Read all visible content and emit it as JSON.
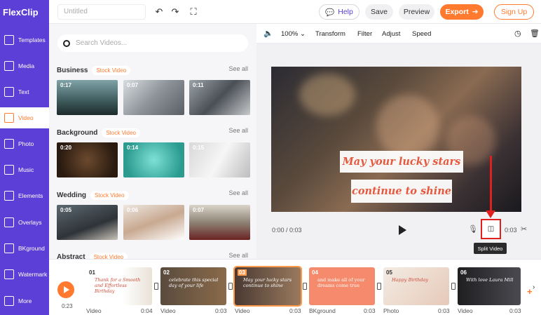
{
  "app": {
    "logo_text": "FlexClip"
  },
  "topbar": {
    "title_placeholder": "Untitled",
    "help_label": "Help",
    "save_label": "Save",
    "preview_label": "Preview",
    "export_label": "Export",
    "signup_label": "Sign Up"
  },
  "leftnav": {
    "items": [
      {
        "label": "Templates",
        "icon": "templates-icon"
      },
      {
        "label": "Media",
        "icon": "media-icon"
      },
      {
        "label": "Text",
        "icon": "text-icon"
      },
      {
        "label": "Video",
        "icon": "video-icon",
        "active": true
      },
      {
        "label": "Photo",
        "icon": "photo-icon"
      },
      {
        "label": "Music",
        "icon": "music-icon"
      },
      {
        "label": "Elements",
        "icon": "elements-icon"
      },
      {
        "label": "Overlays",
        "icon": "overlays-icon"
      },
      {
        "label": "BKground",
        "icon": "background-icon"
      },
      {
        "label": "Watermark",
        "icon": "watermark-icon"
      },
      {
        "label": "More",
        "icon": "more-icon"
      }
    ]
  },
  "panel": {
    "search_placeholder": "Search Videos...",
    "stock_badge": "Stock Video",
    "see_all": "See all",
    "sections": [
      {
        "title": "Business",
        "durations": [
          "0:17",
          "0:07",
          "0:11"
        ]
      },
      {
        "title": "Background",
        "durations": [
          "0:20",
          "0:14",
          "0:15"
        ]
      },
      {
        "title": "Wedding",
        "durations": [
          "0:05",
          "0:06",
          "0:07"
        ]
      },
      {
        "title": "Abstract"
      }
    ]
  },
  "editor": {
    "zoom": "100%",
    "tools": [
      "Transform",
      "Filter",
      "Adjust",
      "Speed"
    ]
  },
  "preview": {
    "caption_line1": "May your lucky stars",
    "caption_line2": "continue to shine",
    "current_time": "0:00 / 0:03",
    "end_time": "0:03",
    "tooltip": "Split Video"
  },
  "timeline": {
    "current_time": "0:23",
    "clips": [
      {
        "num": "01",
        "label": "Video",
        "duration": "0:04",
        "text": "Thank for a Smooth and Effortless Birthday"
      },
      {
        "num": "02",
        "label": "Video",
        "duration": "0:03",
        "text": "celebrate this special day of your life"
      },
      {
        "num": "03",
        "label": "Video",
        "duration": "0:03",
        "text": "May your lucky stars continue to shine",
        "selected": true
      },
      {
        "num": "04",
        "label": "BKground",
        "duration": "0:03",
        "text": "and make all of your dreams come true"
      },
      {
        "num": "05",
        "label": "Photo",
        "duration": "0:03",
        "text": "Happy Birthday"
      },
      {
        "num": "06",
        "label": "Video",
        "duration": "0:03",
        "text": "With love Laura Mill"
      }
    ]
  },
  "colors": {
    "brand": "#5b3fd6",
    "accent": "#ff7a2f",
    "highlight": "#e01f1f"
  }
}
